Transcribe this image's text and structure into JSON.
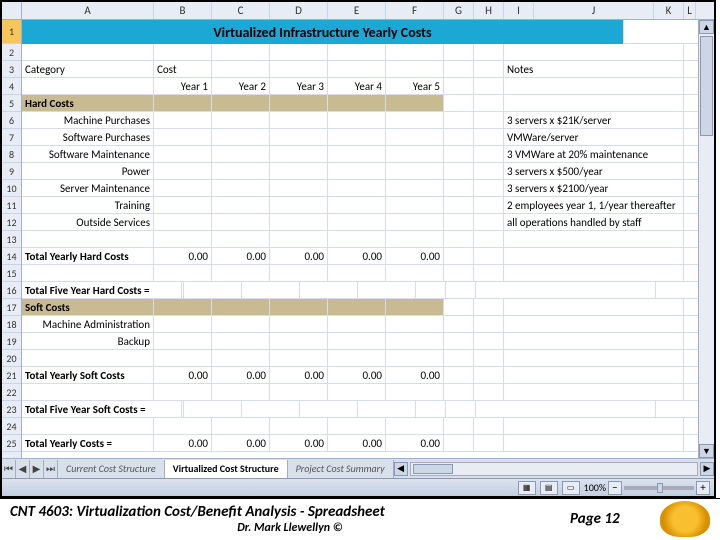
{
  "columns": [
    "A",
    "B",
    "C",
    "D",
    "E",
    "F",
    "G",
    "H",
    "I",
    "J",
    "K",
    "L"
  ],
  "title": "Virtualized Infrastructure Yearly Costs",
  "headers": {
    "category": "Category",
    "cost": "Cost",
    "notes": "Notes"
  },
  "years": [
    "Year 1",
    "Year 2",
    "Year 3",
    "Year 4",
    "Year 5"
  ],
  "sections": {
    "hard": "Hard Costs",
    "soft": "Soft Costs"
  },
  "hard_items": [
    {
      "name": "Machine Purchases",
      "note": "3 servers x $21K/server"
    },
    {
      "name": "Software Purchases",
      "note": "VMWare/server"
    },
    {
      "name": "Software Maintenance",
      "note": "3 VMWare at 20% maintenance"
    },
    {
      "name": "Power",
      "note": "3 servers x $500/year"
    },
    {
      "name": "Server Maintenance",
      "note": "3 servers x $2100/year"
    },
    {
      "name": "Training",
      "note": "2 employees year 1, 1/year thereafter"
    },
    {
      "name": "Outside Services",
      "note": "all operations handled by staff"
    }
  ],
  "soft_items": [
    {
      "name": "Machine Administration"
    },
    {
      "name": "Backup"
    }
  ],
  "totals": {
    "hard_yearly": "Total Yearly Hard Costs",
    "hard_five": "Total Five Year Hard Costs =",
    "soft_yearly": "Total Yearly Soft Costs",
    "soft_five": "Total Five Year Soft Costs =",
    "all_yearly": "Total Yearly Costs ="
  },
  "zero": "0.00",
  "tabs": [
    {
      "label": "Current Cost Structure",
      "active": false
    },
    {
      "label": "Virtualized Cost Structure",
      "active": true
    },
    {
      "label": "Project Cost Summary",
      "active": false
    }
  ],
  "zoom": "100%",
  "footer": {
    "title": "CNT 4603: Virtualization Cost/Benefit Analysis - Spreadsheet",
    "page": "Page 12",
    "author": "Dr. Mark Llewellyn ©"
  }
}
